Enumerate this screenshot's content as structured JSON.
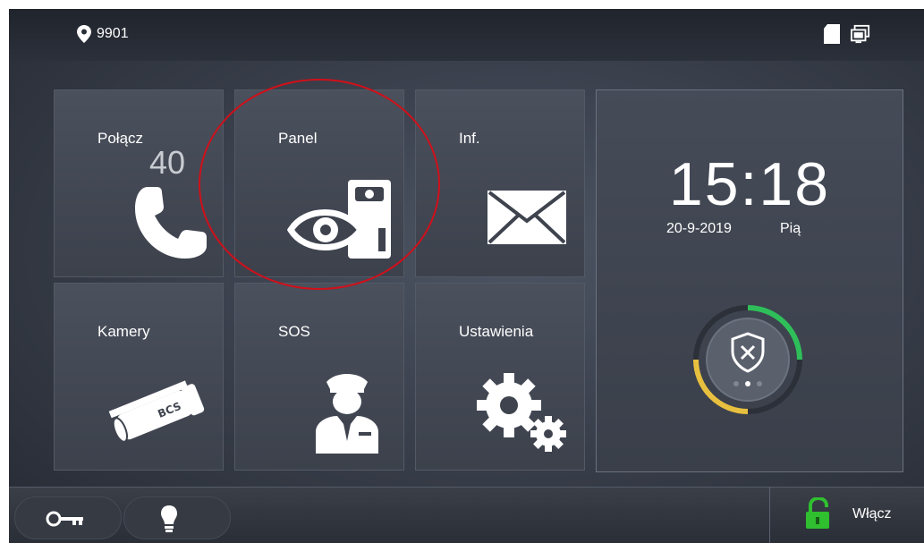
{
  "status_bar": {
    "location_icon": "location-pin-icon",
    "location_number": "9901",
    "icons": [
      "sd-card-icon",
      "monitor-icon"
    ]
  },
  "tiles": [
    {
      "label": "Połącz",
      "icon": "phone-icon",
      "badge": "40"
    },
    {
      "label": "Panel",
      "icon": "door-station-eye-icon"
    },
    {
      "label": "Inf.",
      "icon": "envelope-icon"
    },
    {
      "label": "Kamery",
      "icon": "cctv-camera-icon",
      "camera_brand": "BCS"
    },
    {
      "label": "SOS",
      "icon": "security-guard-icon"
    },
    {
      "label": "Ustawienia",
      "icon": "gears-icon"
    }
  ],
  "clock": {
    "time": "15:18",
    "date": "20-9-2019",
    "day": "Pią"
  },
  "alarm": {
    "icon": "shield-x-icon",
    "ring_colors": [
      "#2fbf5a",
      "#e8c040"
    ]
  },
  "bottom_bar": {
    "key_icon": "key-icon",
    "light_icon": "lightbulb-icon",
    "unlock_icon": "unlock-padlock-icon",
    "unlock_label": "Włącz"
  },
  "annotation": {
    "color": "#d0101a"
  }
}
